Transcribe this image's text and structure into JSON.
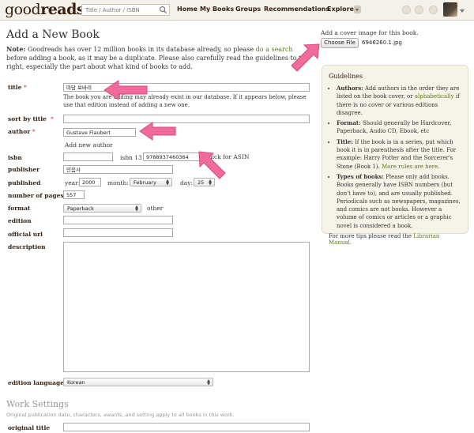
{
  "header": {
    "logo_light": "good",
    "logo_bold": "reads",
    "search_placeholder": "Title / Author / ISBN",
    "nav": {
      "home": "Home",
      "mybooks": "My Books",
      "groups": "Groups",
      "recommendations": "Recommendations",
      "explore": "Explore"
    }
  },
  "page": {
    "title": "Add a New Book",
    "note_label": "Note:",
    "note_part1": "Goodreads has over 12 million books in its database already, so please",
    "note_link": "do a search",
    "note_part2": "before adding a book, as it may be a duplicate. Please also carefully read the guidelines to the right, especially the part about what kind of books to add."
  },
  "form": {
    "title_label": "title",
    "title_value": "마담 보바리",
    "title_help": "The book you are adding may already exist in our database. If it appears below, please use that edition instead of adding a new one.",
    "sort_by_title_label": "sort by title",
    "author_label": "author",
    "author_value": "Gustave Flaubert",
    "add_author_link": "Add new author",
    "isbn_label": "isbn",
    "isbn_value": "",
    "isbn13_label": "isbn 13",
    "isbn13_value": "9788937460364",
    "asin_link": "click for ASIN",
    "publisher_label": "publisher",
    "publisher_value": "민음사",
    "published_label": "published",
    "year_label": "year:",
    "year_value": "2000",
    "month_label": "month:",
    "month_value": "February",
    "day_label": "day:",
    "day_value": "25",
    "pages_label": "number of pages",
    "pages_value": "557",
    "format_label": "format",
    "format_value": "Paperback",
    "other_link": "other",
    "edition_label": "edition",
    "official_url_label": "official url",
    "description_label": "description",
    "edition_language_label": "edition language",
    "edition_language_value": "Korean",
    "work_settings_title": "Work Settings",
    "work_settings_sub": "Original publication date, characters, awards, and setting apply to all books in this work.",
    "original_title_label": "original title"
  },
  "cover": {
    "label": "Add a cover image for this book.",
    "button": "Choose File",
    "filename": "6946260.1.jpg"
  },
  "guidelines": {
    "heading": "Guidelines",
    "authors_label": "Authors:",
    "authors_text": "Add authors in the order they are listed on the book cover, or",
    "authors_alpha": "alphabetically",
    "authors_text2": "if there is no cover or various editions disagree.",
    "format_label": "Format:",
    "format_text": "Should generally be Hardcover, Paperback, Audio CD, Ebook, etc",
    "title_label": "Title:",
    "title_text": "If the book is in a series, put which book it is in parenthesis after the title. For example: Harry Potter and the Sorcerer's Stone (Book 1).",
    "more_rules": "More rules are here.",
    "types_label": "Types of books:",
    "types_text": "Please only add books. Books generally have ISBN numbers (but don't have to), and are usually published. Periodicals such as newspapers, magazines, and comics are not books. However a volume of comics or articles or a graphic novel is considered a book.",
    "tips_text": "For more tips please read the",
    "tips_link": "Librarian Manual."
  },
  "colors": {
    "annotation_arrow": "#f06a9a",
    "link": "#5a7a14",
    "header_bg": "#f4f1ea",
    "guide_bg": "#f6f3e8"
  },
  "icons": [
    "search-icon",
    "avatar",
    "pink-arrow-annotation"
  ]
}
